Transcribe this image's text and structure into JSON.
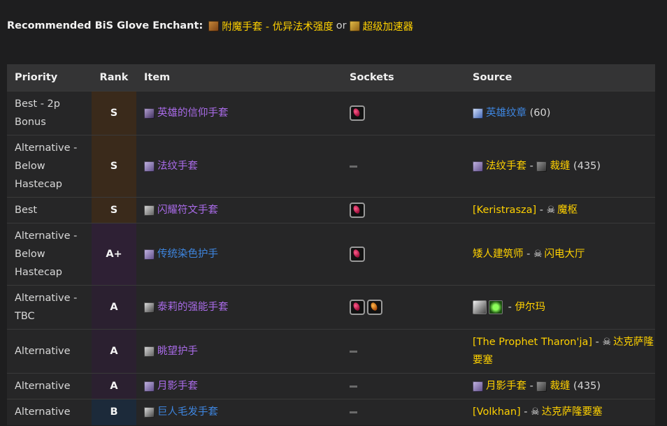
{
  "header": {
    "lead": "Recommended BiS Glove Enchant",
    "colon": ":",
    "enchant1": "附魔手套 - 优异法术强度",
    "or": "or",
    "enchant2": "超级加速器"
  },
  "table": {
    "headers": {
      "priority": "Priority",
      "rank": "Rank",
      "item": "Item",
      "sockets": "Sockets",
      "source": "Source"
    },
    "rows": [
      {
        "priority": "Best - 2p Bonus",
        "rank": "S",
        "item": "英雄的信仰手套",
        "source": {
          "a": "英雄纹章",
          "b": " (60)"
        }
      },
      {
        "priority": "Alternative - Below Hastecap",
        "rank": "S",
        "item": "法纹手套",
        "source": {
          "a": "法纹手套",
          "sep": " - ",
          "b": "裁缝",
          "c": " (435)"
        }
      },
      {
        "priority": "Best",
        "rank": "S",
        "item": "闪耀符文手套",
        "source": {
          "a": "[Keristrasza]",
          "sep": " - ",
          "b": "魔枢"
        }
      },
      {
        "priority": "Alternative - Below Hastecap",
        "rank": "A+",
        "item": "传统染色护手",
        "source": {
          "a": "矮人建筑师",
          "sep": " - ",
          "b": "闪电大厅"
        }
      },
      {
        "priority": "Alternative - TBC",
        "rank": "A",
        "item": "泰莉的强能手套",
        "source": {
          "sep": " - ",
          "b": "伊尔玛"
        }
      },
      {
        "priority": "Alternative",
        "rank": "A",
        "item": "眺望护手",
        "source": {
          "a": "[The Prophet Tharon'ja]",
          "sep": " - ",
          "b": "达克萨隆要塞"
        }
      },
      {
        "priority": "Alternative",
        "rank": "A",
        "item": "月影手套",
        "source": {
          "a": "月影手套",
          "sep": " - ",
          "b": "裁缝",
          "c": " (435)"
        }
      },
      {
        "priority": "Alternative",
        "rank": "B",
        "item": "巨人毛发手套",
        "source": {
          "a": "[Volkhan]",
          "sep": " - ",
          "b": "达克萨隆要塞"
        }
      }
    ]
  },
  "colors": {
    "gold": "#ffd100",
    "epic": "#a96be8",
    "rare": "#3e86e0",
    "background": "#1e1e1f"
  }
}
